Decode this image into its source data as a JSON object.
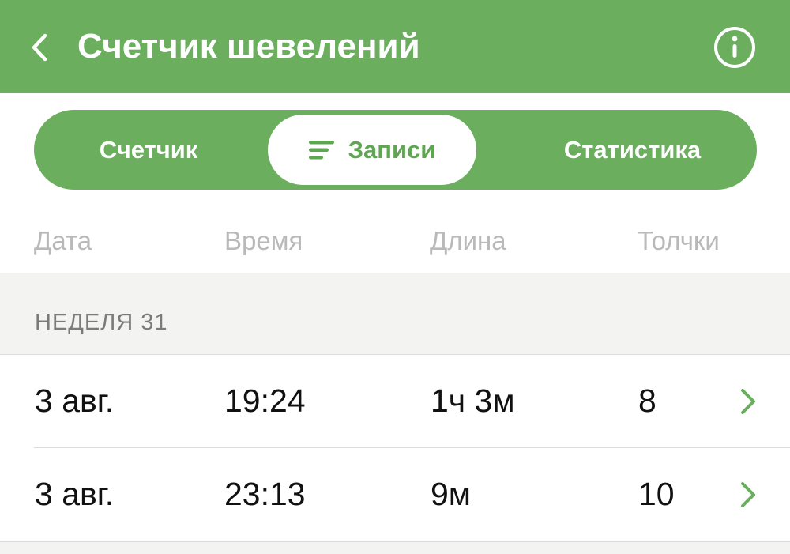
{
  "header": {
    "title": "Счетчик шевелений",
    "back_icon": "chevron-left-icon",
    "info_icon": "info-circle-icon",
    "background_color": "#6aae5e"
  },
  "segmented": {
    "items": [
      {
        "label": "Счетчик",
        "active": false
      },
      {
        "label": "Записи",
        "active": true,
        "icon": "list-icon"
      },
      {
        "label": "Статистика",
        "active": false
      }
    ],
    "accent_color": "#6aae5e"
  },
  "columns": [
    "Дата",
    "Время",
    "Длина",
    "Толчки"
  ],
  "sections": [
    {
      "label": "НЕДЕЛЯ 31",
      "rows": [
        {
          "date": "3 авг.",
          "time": "19:24",
          "length": "1ч 3м",
          "kicks": "8"
        },
        {
          "date": "3 авг.",
          "time": "23:13",
          "length": "9м",
          "kicks": "10"
        }
      ]
    }
  ]
}
